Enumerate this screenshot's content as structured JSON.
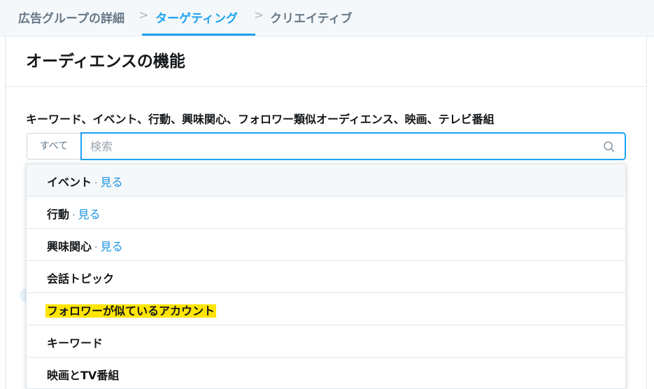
{
  "breadcrumbs": {
    "step1": "広告グループの詳細",
    "step2": "ターゲティング",
    "step3": "クリエイティブ",
    "separator": ">"
  },
  "card": {
    "title": "オーディエンスの機能",
    "section_label": "キーワード、イベント、行動、興味関心、フォロワー類似オーディエンス、映画、テレビ番組"
  },
  "search": {
    "scope_label": "すべて",
    "placeholder": "検索",
    "value": ""
  },
  "dropdown": {
    "items": [
      {
        "label": "イベント",
        "link": "見る"
      },
      {
        "label": "行動",
        "link": "見る"
      },
      {
        "label": "興味関心",
        "link": "見る"
      },
      {
        "label": "会話トピック"
      },
      {
        "label": "フォロワーが似ているアカウント",
        "highlighted": true
      },
      {
        "label": "キーワード"
      },
      {
        "label": "映画とTV番組"
      }
    ],
    "dot": "·"
  },
  "colors": {
    "accent": "#1da1f2",
    "link": "#1b95e0",
    "highlight": "#ffe500"
  }
}
